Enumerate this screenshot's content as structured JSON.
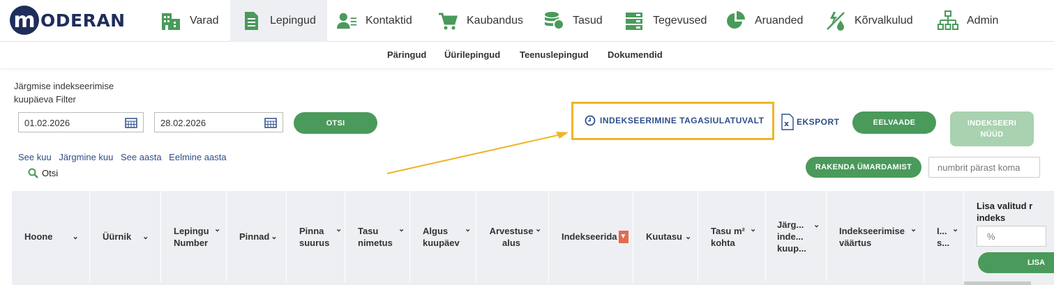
{
  "brand": {
    "logo_letter": "m",
    "logo_text": "ODERAN",
    "primary": "#1f2d5a",
    "green": "#4a9a5b",
    "highlight": "#f0b429"
  },
  "nav": {
    "items": [
      {
        "label": "Varad",
        "icon": "buildings-icon"
      },
      {
        "label": "Lepingud",
        "icon": "document-icon",
        "active": true
      },
      {
        "label": "Kontaktid",
        "icon": "contacts-icon"
      },
      {
        "label": "Kaubandus",
        "icon": "cart-icon"
      },
      {
        "label": "Tasud",
        "icon": "coins-icon"
      },
      {
        "label": "Tegevused",
        "icon": "tasks-icon"
      },
      {
        "label": "Aruanded",
        "icon": "pie-chart-icon"
      },
      {
        "label": "Kõrvalkulud",
        "icon": "utilities-icon"
      },
      {
        "label": "Admin",
        "icon": "org-chart-icon"
      }
    ]
  },
  "subnav": {
    "items": [
      "Päringud",
      "Üürilepingud",
      "Teenuslepingud",
      "Dokumendid"
    ]
  },
  "filter": {
    "label": "Järgmise indekseerimise kuupäeva Filter",
    "date_from": "01.02.2026",
    "date_to": "28.02.2026",
    "search_button": "OTSI",
    "quick_links": [
      "See kuu",
      "Järgmine kuu",
      "See aasta",
      "Eelmine aasta"
    ],
    "search_link": "Otsi"
  },
  "actions": {
    "history": "INDEKSEERIMINE TAGASIULATUVALT",
    "export": "EKSPORT",
    "preview": "EELVAADE",
    "index_now": "INDEKSEERI NÜÜD",
    "apply_rounding": "RAKENDA ÜMARDAMIST",
    "rounding_placeholder": "numbrit pärast koma"
  },
  "table": {
    "columns": [
      "Hoone",
      "Üürnik",
      "Lepingu Number",
      "Pinnad",
      "Pinna suurus",
      "Tasu nimetus",
      "Algus kuupäev",
      "Arvestuse alus",
      "Indekseerida",
      "Kuutasu",
      "Tasu m² kohta",
      "Järg... inde... kuup...",
      "Indekseerimise väärtus",
      "I... s..."
    ],
    "add_index_title": "Lisa valitud r indeks",
    "add_index_placeholder": "%",
    "add_button": "LISA"
  }
}
